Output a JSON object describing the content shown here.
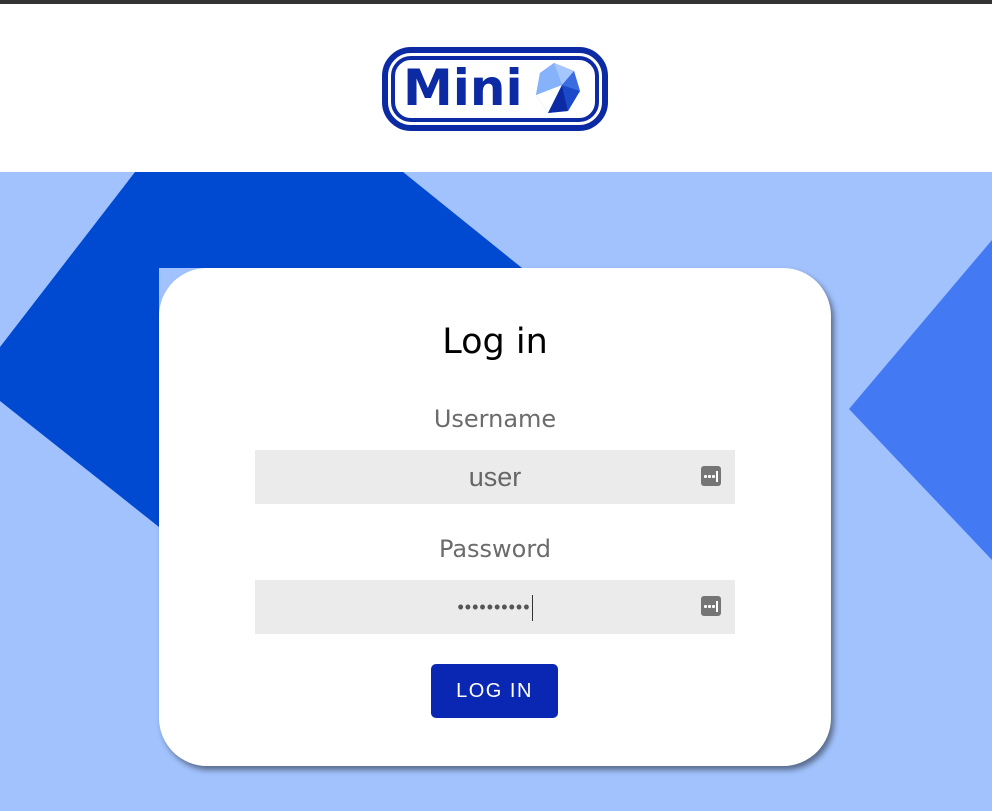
{
  "logo": {
    "text": "Mini"
  },
  "login": {
    "title": "Log in",
    "username_label": "Username",
    "username_value": "user",
    "password_label": "Password",
    "password_value": "••••••••••",
    "submit_label": "LOG IN"
  },
  "icons": [
    "logo-icon",
    "key-icon",
    "key-icon"
  ],
  "colors": {
    "brand_dark": "#0b2aa3",
    "button": "#0a27b3",
    "background_light": "#a1c2fd",
    "shape_dark": "#0049d1",
    "shape_mid": "#4379f3"
  }
}
